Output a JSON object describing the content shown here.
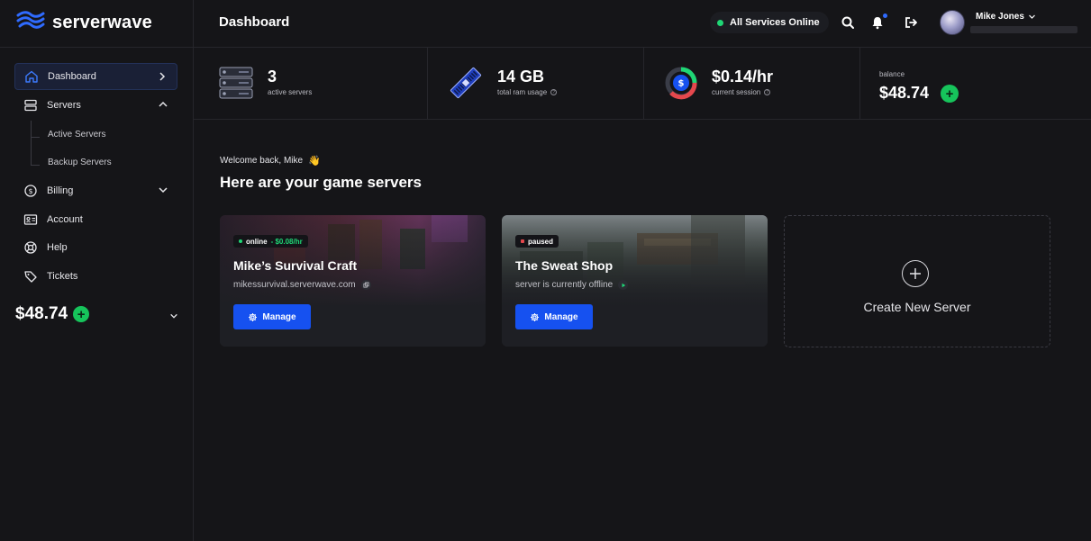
{
  "brand": {
    "name": "serverwave",
    "accent": "#2f6bff"
  },
  "header": {
    "title": "Dashboard",
    "status": "All Services Online",
    "user_name": "Mike Jones"
  },
  "sidebar": {
    "items": [
      {
        "label": "Dashboard",
        "icon": "home-icon",
        "active": true
      },
      {
        "label": "Servers",
        "icon": "server-icon",
        "expanded": true
      },
      {
        "label": "Billing",
        "icon": "dollar-icon"
      },
      {
        "label": "Account",
        "icon": "id-card-icon"
      },
      {
        "label": "Help",
        "icon": "lifebuoy-icon"
      },
      {
        "label": "Tickets",
        "icon": "tag-icon"
      }
    ],
    "sub_items": [
      "Active Servers",
      "Backup Servers"
    ],
    "balance": "$48.74"
  },
  "stats": {
    "servers": {
      "value": "3",
      "label": "active servers"
    },
    "ram": {
      "value": "14 GB",
      "label": "total ram usage"
    },
    "session": {
      "value": "$0.14/hr",
      "label": "current session"
    },
    "balance": {
      "label": "balance",
      "value": "$48.74"
    }
  },
  "main": {
    "welcome": "Welcome back, Mike",
    "welcome_emoji": "👋",
    "title": "Here are your game servers",
    "servers": [
      {
        "status": "online",
        "rate": " - $0.08/hr",
        "status_color": "#1fd675",
        "name": "Mike’s Survival Craft",
        "subtitle": "mikessurvival.serverwave.com",
        "button": "Manage"
      },
      {
        "status": "paused",
        "rate": "",
        "status_color": "#e5484d",
        "name": "The Sweat Shop",
        "subtitle": "server is currently offline",
        "button": "Manage"
      }
    ],
    "create_label": "Create New Server"
  }
}
